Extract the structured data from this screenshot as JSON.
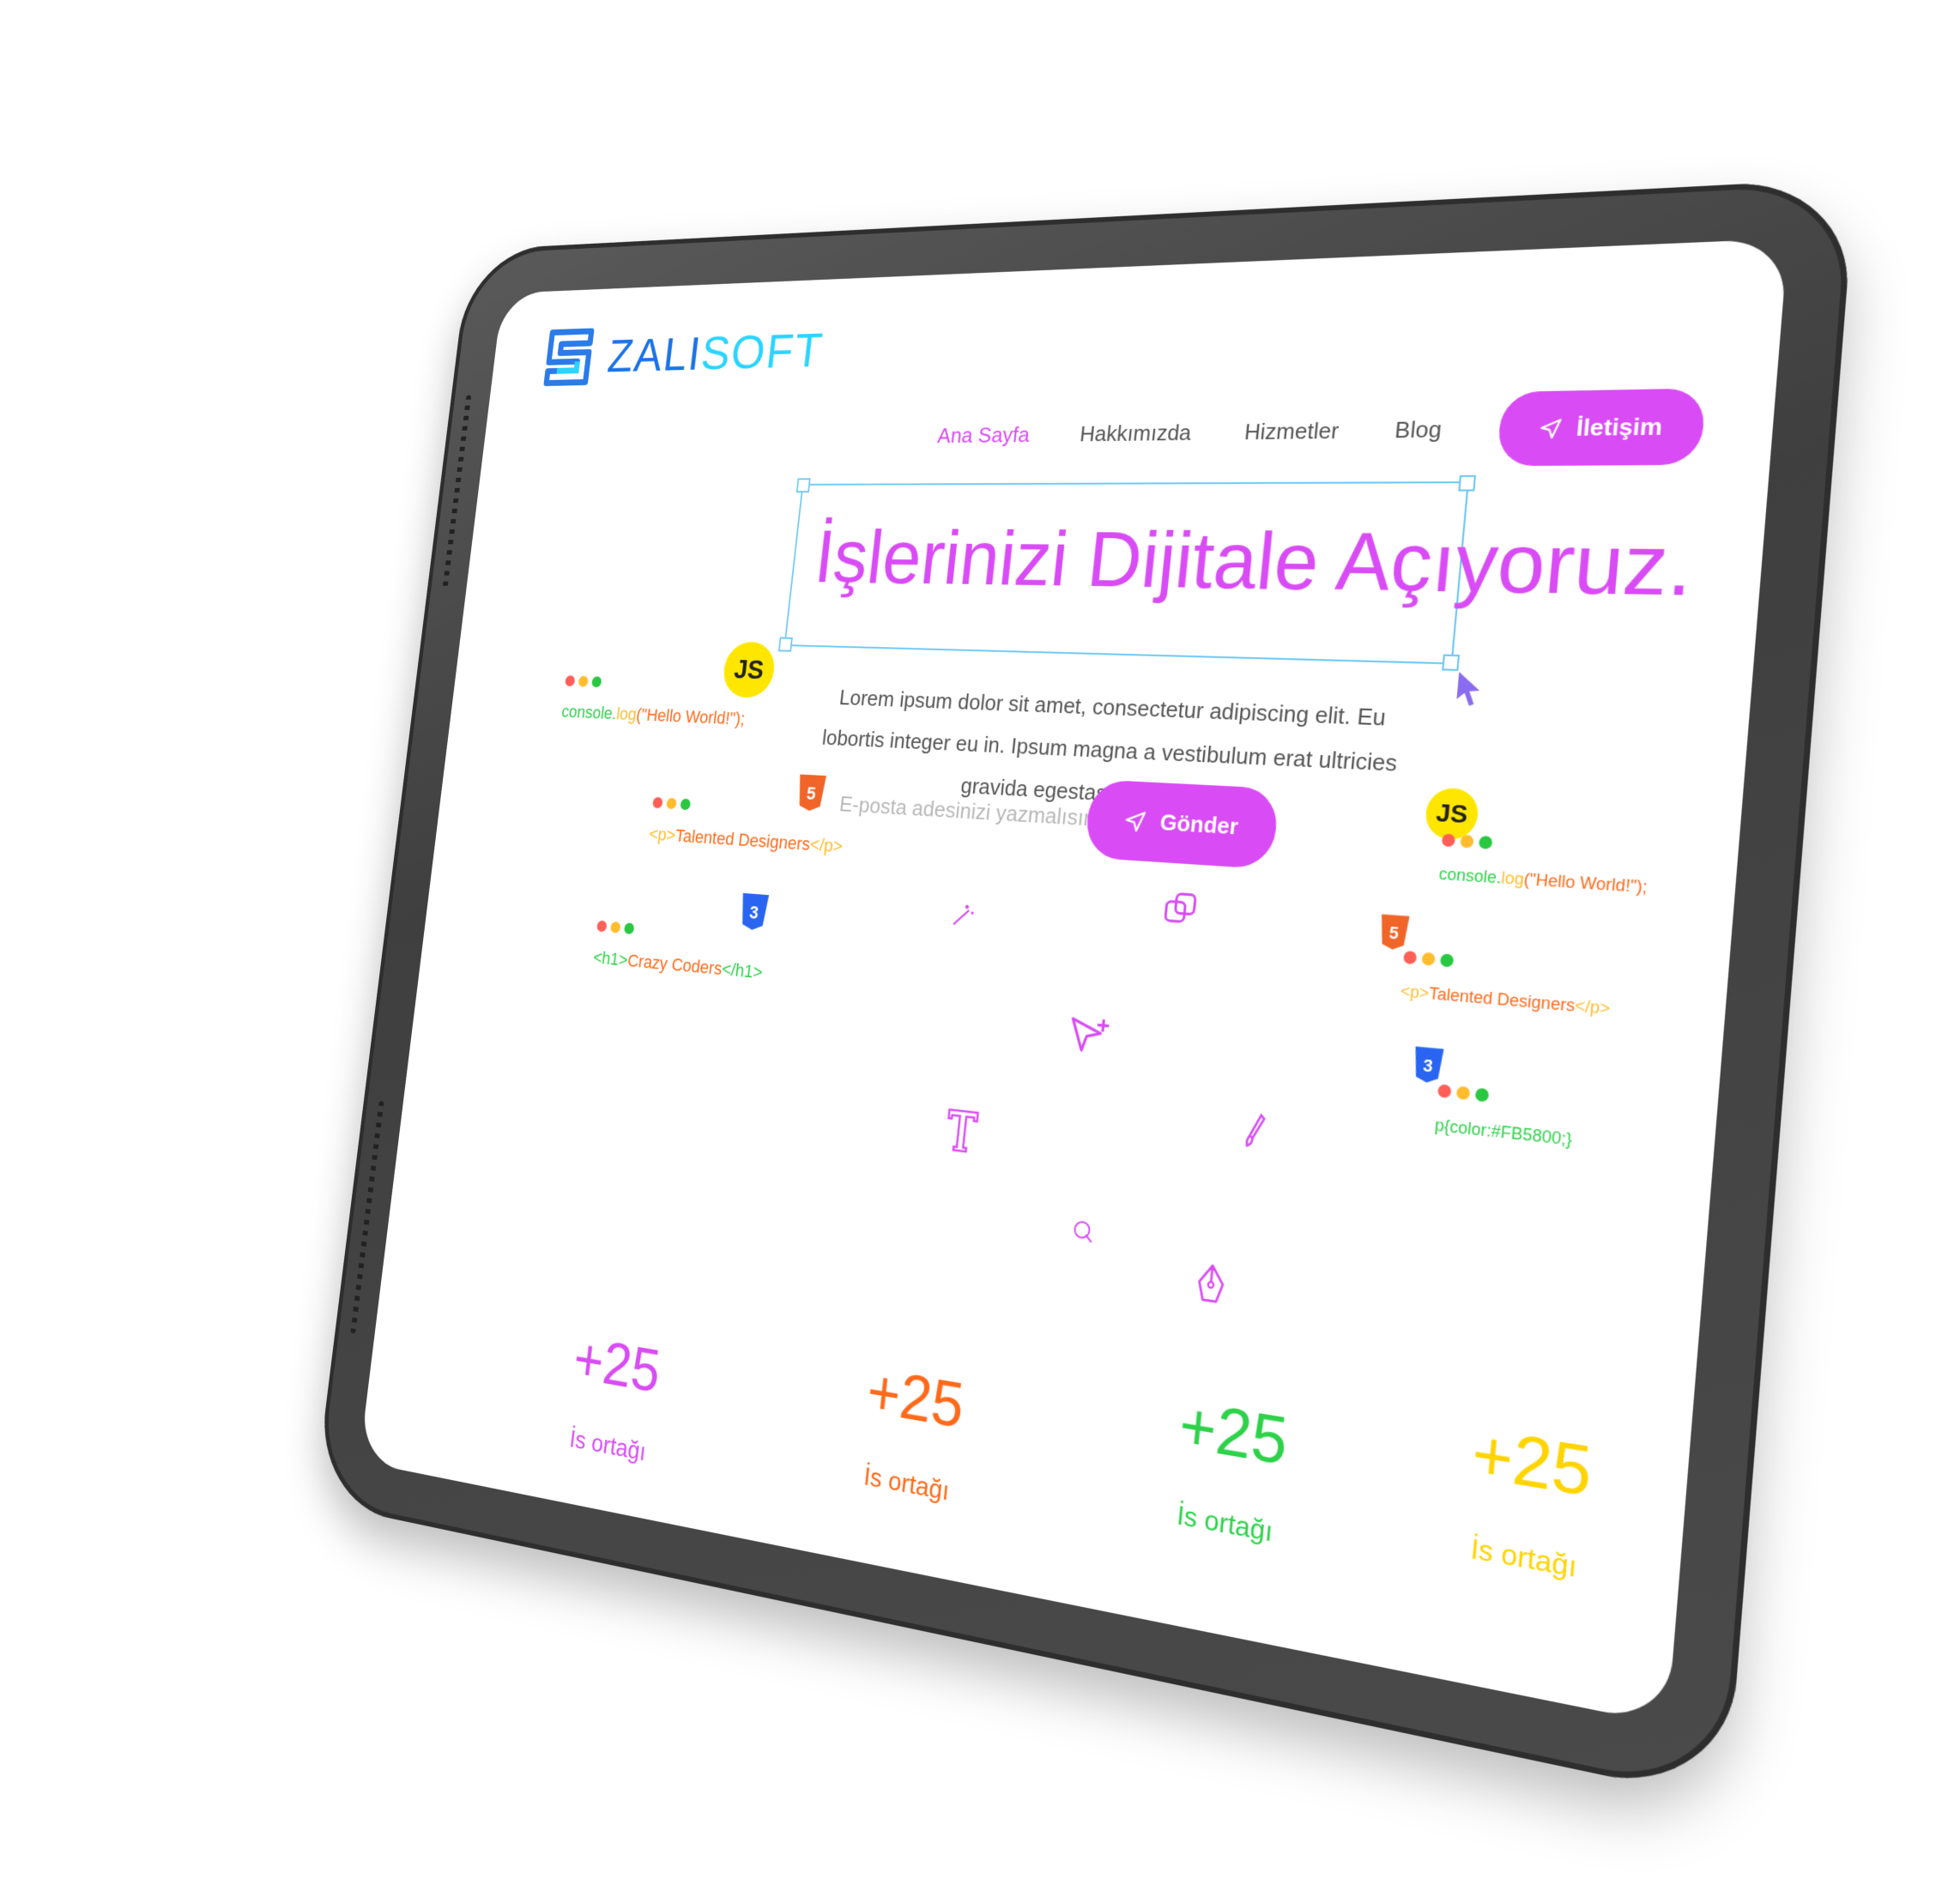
{
  "logo": {
    "text_main": "ZALI",
    "text_accent": "SOFT"
  },
  "nav": {
    "items": [
      "Ana Sayfa",
      "Hakkımızda",
      "Hizmetler",
      "Blog"
    ],
    "cta": "İletişim"
  },
  "hero": {
    "title": "İşlerinizi Dijitale Açıyoruz.",
    "description": "Lorem ipsum dolor sit amet, consectetur adipiscing elit. Eu lobortis integer eu in. Ipsum magna a vestibulum erat ultricies gravida egestas amet turpis."
  },
  "form": {
    "email_placeholder": "E-posta adesinizi yazmalısınız :)",
    "submit_label": "Gönder"
  },
  "badges": {
    "js": "JS"
  },
  "snippets": {
    "console_prefix": "console.",
    "console_method": "log",
    "console_args": "(\"Hello World!\");",
    "console_args_short": "(\"Hello World!\");",
    "p_open": "<p>",
    "p_text": "Talented Designers",
    "p_close": "</p>",
    "h1_open": "<h1>",
    "h1_text": "Crazy Coders",
    "h1_close": "</h1>",
    "css_rule": "p{color:#FB5800;}"
  },
  "stats": [
    {
      "value": "+25",
      "label": "İs ortağı",
      "color": "#d94cf5"
    },
    {
      "value": "+25",
      "label": "İs ortağı",
      "color": "#ff6a1a"
    },
    {
      "value": "+25",
      "label": "İs ortağı",
      "color": "#2ed24a"
    },
    {
      "value": "+25",
      "label": "İs ortağı",
      "color": "#ffd400"
    }
  ],
  "colors": {
    "accent": "#d94cf5",
    "dot_red": "#ff5f57",
    "dot_yellow": "#ffbd2e",
    "dot_green": "#28c840",
    "html5": "#f16529",
    "css3": "#2965f1",
    "js": "#ffe600"
  },
  "icons": [
    "send-icon",
    "magic-wand-icon",
    "overlap-icon",
    "cursor-plus-icon",
    "brush-icon",
    "text-tool-icon",
    "pen-tool-icon",
    "color-drop-icon"
  ]
}
